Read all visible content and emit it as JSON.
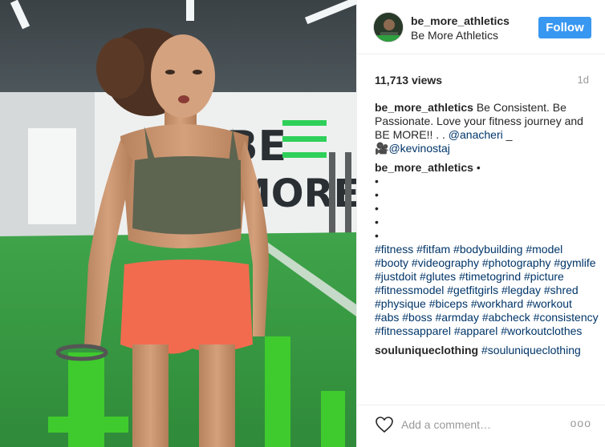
{
  "post": {
    "media_alt": "Woman in sports top and orange shorts training at the gym",
    "brand_wall_text": [
      "BE",
      "MORE"
    ]
  },
  "header": {
    "username": "be_more_athletics",
    "full_name": "Be More Athletics",
    "follow_label": "Follow"
  },
  "stats": {
    "views": "11,713 views",
    "age": "1d"
  },
  "comments": [
    {
      "user": "be_more_athletics",
      "text_before": "Be Consistent. Be Passionate. Love your fitness journey and BE MORE!! . . ",
      "mention1": "@anacheri",
      "text_mid": " _",
      "camera_icon": "🎥",
      "mention2": "@kevinostaj"
    },
    {
      "user": "be_more_athletics",
      "bullets": [
        "•",
        "•",
        "•",
        "•",
        "•",
        "•"
      ],
      "hashtags": "#fitness #fitfam #bodybuilding #model #booty #videography #photography #gymlife #justdoit #glutes #timetogrind #picture #fitnessmodel #getfitgirls #legday #shred #physique #biceps #workhard #workout #abs #boss #armday #abcheck #consistency #fitnessapparel #apparel #workoutclothes"
    },
    {
      "user": "souluniqueclothing",
      "hashtags": "#souluniqueclothing"
    }
  ],
  "footer": {
    "heart_icon": "heart-outline-icon",
    "add_comment_placeholder": "Add a comment…",
    "more_label": "ooo"
  },
  "colors": {
    "follow_bg": "#3897f0",
    "link": "#003569",
    "brand_green": "#2fd05a"
  }
}
